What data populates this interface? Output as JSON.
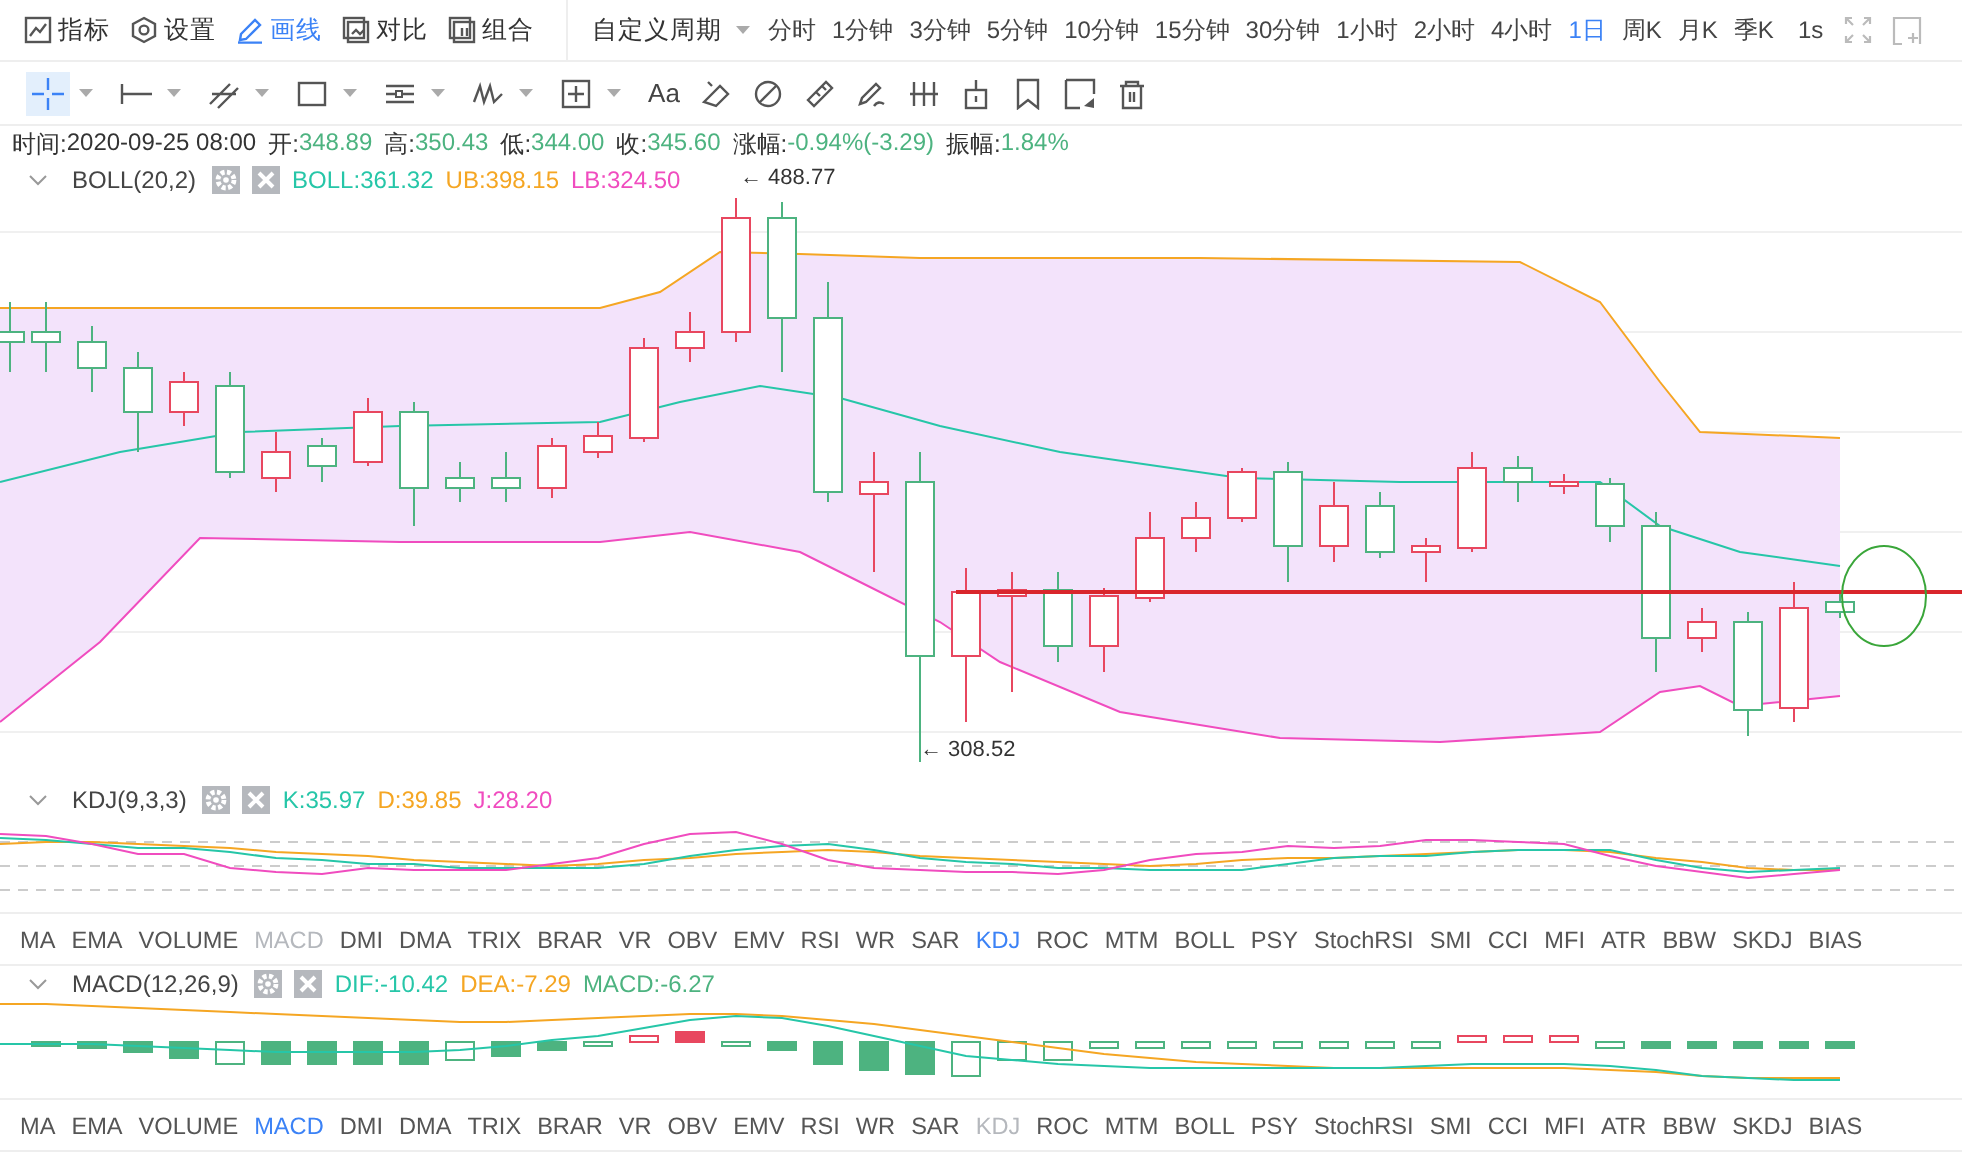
{
  "main_toolbar": [
    {
      "label": "指标",
      "selected": false
    },
    {
      "label": "设置",
      "selected": false
    },
    {
      "label": "画线",
      "selected": true
    },
    {
      "label": "对比",
      "selected": false
    },
    {
      "label": "组合",
      "selected": false
    }
  ],
  "custom_period": {
    "label": "自定义周期"
  },
  "periods": [
    {
      "label": "分时",
      "selected": false
    },
    {
      "label": "1分钟",
      "selected": false
    },
    {
      "label": "3分钟",
      "selected": false
    },
    {
      "label": "5分钟",
      "selected": false
    },
    {
      "label": "10分钟",
      "selected": false
    },
    {
      "label": "15分钟",
      "selected": false
    },
    {
      "label": "30分钟",
      "selected": false
    },
    {
      "label": "1小时",
      "selected": false
    },
    {
      "label": "2小时",
      "selected": false
    },
    {
      "label": "4小时",
      "selected": false
    },
    {
      "label": "1日",
      "selected": true
    },
    {
      "label": "周K",
      "selected": false
    },
    {
      "label": "月K",
      "selected": false
    },
    {
      "label": "季K",
      "selected": false
    }
  ],
  "interval_label": "1s",
  "drawing_tools": [
    {
      "selected": true,
      "has_menu": true
    },
    {
      "selected": false,
      "has_menu": true
    },
    {
      "selected": false,
      "has_menu": true
    },
    {
      "selected": false,
      "has_menu": true
    },
    {
      "selected": false,
      "has_menu": true
    },
    {
      "selected": false,
      "has_menu": true
    },
    {
      "selected": false,
      "has_menu": true
    },
    {
      "selected": false,
      "has_menu": false,
      "label": "Aa"
    },
    {
      "selected": false,
      "has_menu": false
    },
    {
      "selected": false,
      "has_menu": false
    },
    {
      "selected": false,
      "has_menu": false
    },
    {
      "selected": false,
      "has_menu": false
    },
    {
      "selected": false,
      "has_menu": false
    },
    {
      "selected": false,
      "has_menu": false
    },
    {
      "selected": false,
      "has_menu": false
    },
    {
      "selected": false,
      "has_menu": false
    },
    {
      "selected": false,
      "has_menu": false
    }
  ],
  "quote": [
    {
      "label": "时间:",
      "value": "2020-09-25 08:00",
      "color": "#333333"
    },
    {
      "label": "开:",
      "value": "348.89",
      "color": "#4db380"
    },
    {
      "label": "高:",
      "value": "350.43",
      "color": "#4db380"
    },
    {
      "label": "低:",
      "value": "344.00",
      "color": "#4db380"
    },
    {
      "label": "收:",
      "value": "345.60",
      "color": "#4db380"
    },
    {
      "label": "涨幅:",
      "value": "-0.94%(-3.29)",
      "color": "#4db380"
    },
    {
      "label": "振幅:",
      "value": "1.84%",
      "color": "#4db380"
    }
  ],
  "main_indicator": {
    "name": "BOLL(20,2)",
    "values": [
      {
        "text": "BOLL:361.32",
        "color": "#26c6a8"
      },
      {
        "text": "UB:398.15",
        "color": "#f5a623"
      },
      {
        "text": "LB:324.50",
        "color": "#f04cbf"
      }
    ],
    "high_marker": "← 488.77",
    "low_marker": "← 308.52"
  },
  "kdj_pane": {
    "name": "KDJ(9,3,3)",
    "values": [
      {
        "text": "K:35.97",
        "color": "#26c6a8"
      },
      {
        "text": "D:39.85",
        "color": "#f5a623"
      },
      {
        "text": "J:28.20",
        "color": "#f04cbf"
      }
    ]
  },
  "indicator_tabs_1": [
    {
      "label": "MA",
      "selected": false,
      "disabled": false
    },
    {
      "label": "EMA",
      "selected": false,
      "disabled": false
    },
    {
      "label": "VOLUME",
      "selected": false,
      "disabled": false
    },
    {
      "label": "MACD",
      "selected": false,
      "disabled": true
    },
    {
      "label": "DMI",
      "selected": false,
      "disabled": false
    },
    {
      "label": "DMA",
      "selected": false,
      "disabled": false
    },
    {
      "label": "TRIX",
      "selected": false,
      "disabled": false
    },
    {
      "label": "BRAR",
      "selected": false,
      "disabled": false
    },
    {
      "label": "VR",
      "selected": false,
      "disabled": false
    },
    {
      "label": "OBV",
      "selected": false,
      "disabled": false
    },
    {
      "label": "EMV",
      "selected": false,
      "disabled": false
    },
    {
      "label": "RSI",
      "selected": false,
      "disabled": false
    },
    {
      "label": "WR",
      "selected": false,
      "disabled": false
    },
    {
      "label": "SAR",
      "selected": false,
      "disabled": false
    },
    {
      "label": "KDJ",
      "selected": true,
      "disabled": false
    },
    {
      "label": "ROC",
      "selected": false,
      "disabled": false
    },
    {
      "label": "MTM",
      "selected": false,
      "disabled": false
    },
    {
      "label": "BOLL",
      "selected": false,
      "disabled": false
    },
    {
      "label": "PSY",
      "selected": false,
      "disabled": false
    },
    {
      "label": "StochRSI",
      "selected": false,
      "disabled": false
    },
    {
      "label": "SMI",
      "selected": false,
      "disabled": false
    },
    {
      "label": "CCI",
      "selected": false,
      "disabled": false
    },
    {
      "label": "MFI",
      "selected": false,
      "disabled": false
    },
    {
      "label": "ATR",
      "selected": false,
      "disabled": false
    },
    {
      "label": "BBW",
      "selected": false,
      "disabled": false
    },
    {
      "label": "SKDJ",
      "selected": false,
      "disabled": false
    },
    {
      "label": "BIAS",
      "selected": false,
      "disabled": false
    }
  ],
  "macd_pane": {
    "name": "MACD(12,26,9)",
    "values": [
      {
        "text": "DIF:-10.42",
        "color": "#26c6a8"
      },
      {
        "text": "DEA:-7.29",
        "color": "#f5a623"
      },
      {
        "text": "MACD:-6.27",
        "color": "#4db380"
      }
    ]
  },
  "indicator_tabs_2": [
    {
      "label": "MA",
      "selected": false,
      "disabled": false
    },
    {
      "label": "EMA",
      "selected": false,
      "disabled": false
    },
    {
      "label": "VOLUME",
      "selected": false,
      "disabled": false
    },
    {
      "label": "MACD",
      "selected": true,
      "disabled": false
    },
    {
      "label": "DMI",
      "selected": false,
      "disabled": false
    },
    {
      "label": "DMA",
      "selected": false,
      "disabled": false
    },
    {
      "label": "TRIX",
      "selected": false,
      "disabled": false
    },
    {
      "label": "BRAR",
      "selected": false,
      "disabled": false
    },
    {
      "label": "VR",
      "selected": false,
      "disabled": false
    },
    {
      "label": "OBV",
      "selected": false,
      "disabled": false
    },
    {
      "label": "EMV",
      "selected": false,
      "disabled": false
    },
    {
      "label": "RSI",
      "selected": false,
      "disabled": false
    },
    {
      "label": "WR",
      "selected": false,
      "disabled": false
    },
    {
      "label": "SAR",
      "selected": false,
      "disabled": false
    },
    {
      "label": "KDJ",
      "selected": false,
      "disabled": true
    },
    {
      "label": "ROC",
      "selected": false,
      "disabled": false
    },
    {
      "label": "MTM",
      "selected": false,
      "disabled": false
    },
    {
      "label": "BOLL",
      "selected": false,
      "disabled": false
    },
    {
      "label": "PSY",
      "selected": false,
      "disabled": false
    },
    {
      "label": "StochRSI",
      "selected": false,
      "disabled": false
    },
    {
      "label": "SMI",
      "selected": false,
      "disabled": false
    },
    {
      "label": "CCI",
      "selected": false,
      "disabled": false
    },
    {
      "label": "MFI",
      "selected": false,
      "disabled": false
    },
    {
      "label": "ATR",
      "selected": false,
      "disabled": false
    },
    {
      "label": "BBW",
      "selected": false,
      "disabled": false
    },
    {
      "label": "SKDJ",
      "selected": false,
      "disabled": false
    },
    {
      "label": "BIAS",
      "selected": false,
      "disabled": false
    }
  ]
}
